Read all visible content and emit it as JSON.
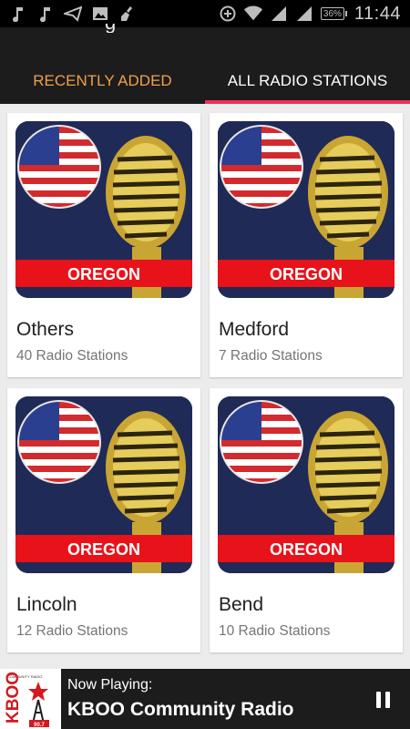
{
  "status_bar": {
    "icons_left": [
      "music-note-icon",
      "music-note-icon",
      "send-icon",
      "image-icon",
      "broom-icon"
    ],
    "icons_right": [
      "data-saver-icon",
      "wifi-icon",
      "signal-icon",
      "signal-icon"
    ],
    "battery_percent": "36%",
    "time": "11:44"
  },
  "tabs": [
    {
      "label": "RECENTLY ADDED",
      "active": false,
      "color": "#f0a04b"
    },
    {
      "label": "ALL RADIO STATIONS",
      "active": true,
      "color": "#ffffff"
    }
  ],
  "tab_indicator_color": "#ee3158",
  "cards": [
    {
      "title": "Others",
      "subtitle": "40 Radio Stations",
      "banner": "OREGON"
    },
    {
      "title": "Medford",
      "subtitle": "7 Radio Stations",
      "banner": "OREGON"
    },
    {
      "title": "Lincoln",
      "subtitle": "12 Radio Stations",
      "banner": "OREGON"
    },
    {
      "title": "Bend",
      "subtitle": "10 Radio Stations",
      "banner": "OREGON"
    }
  ],
  "player": {
    "label": "Now Playing:",
    "station": "KBOO Community Radio",
    "logo_text": "KBOO",
    "logo_caption": "COMMUNITY RADIO",
    "logo_freq": "90.7",
    "control_icon": "pause-icon"
  },
  "colors": {
    "background": "#ececec",
    "appbar": "#1c1c1c",
    "card_bg": "#ffffff",
    "thumb_bg": "#202a56",
    "banner_red": "#e8121a",
    "mic_gold": "#d6b646"
  }
}
